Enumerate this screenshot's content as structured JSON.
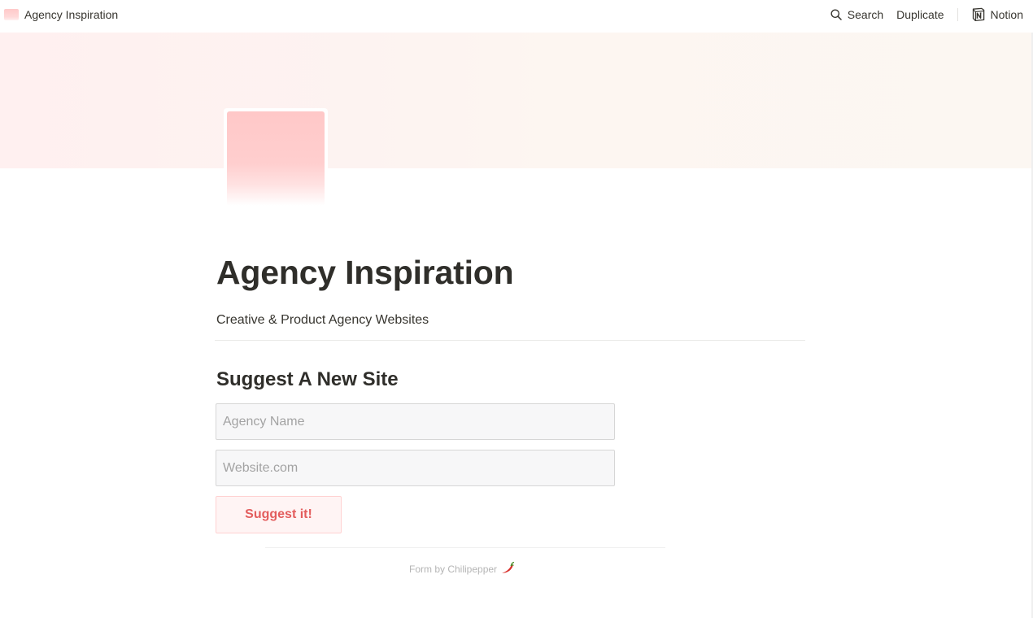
{
  "topbar": {
    "breadcrumb_title": "Agency Inspiration",
    "search_label": "Search",
    "duplicate_label": "Duplicate",
    "notion_label": "Notion"
  },
  "page": {
    "title": "Agency Inspiration",
    "subtitle": "Creative & Product Agency Websites"
  },
  "form": {
    "heading": "Suggest A New Site",
    "agency_name_placeholder": "Agency Name",
    "agency_name_value": "",
    "website_placeholder": "Website.com",
    "website_value": "",
    "submit_label": "Suggest it!",
    "credit": "Form by Chilipepper"
  },
  "icons": {
    "page_icon": "pink-gradient-square",
    "search": "search-icon",
    "notion": "notion-logo-icon",
    "chili": "chili-pepper-icon"
  },
  "colors": {
    "accent_text": "#e35d5d",
    "button_bg": "#fff4f4",
    "button_border": "#ffd2d2",
    "icon_pink": "#ffc8c8",
    "input_bg": "#f7f7f8"
  }
}
